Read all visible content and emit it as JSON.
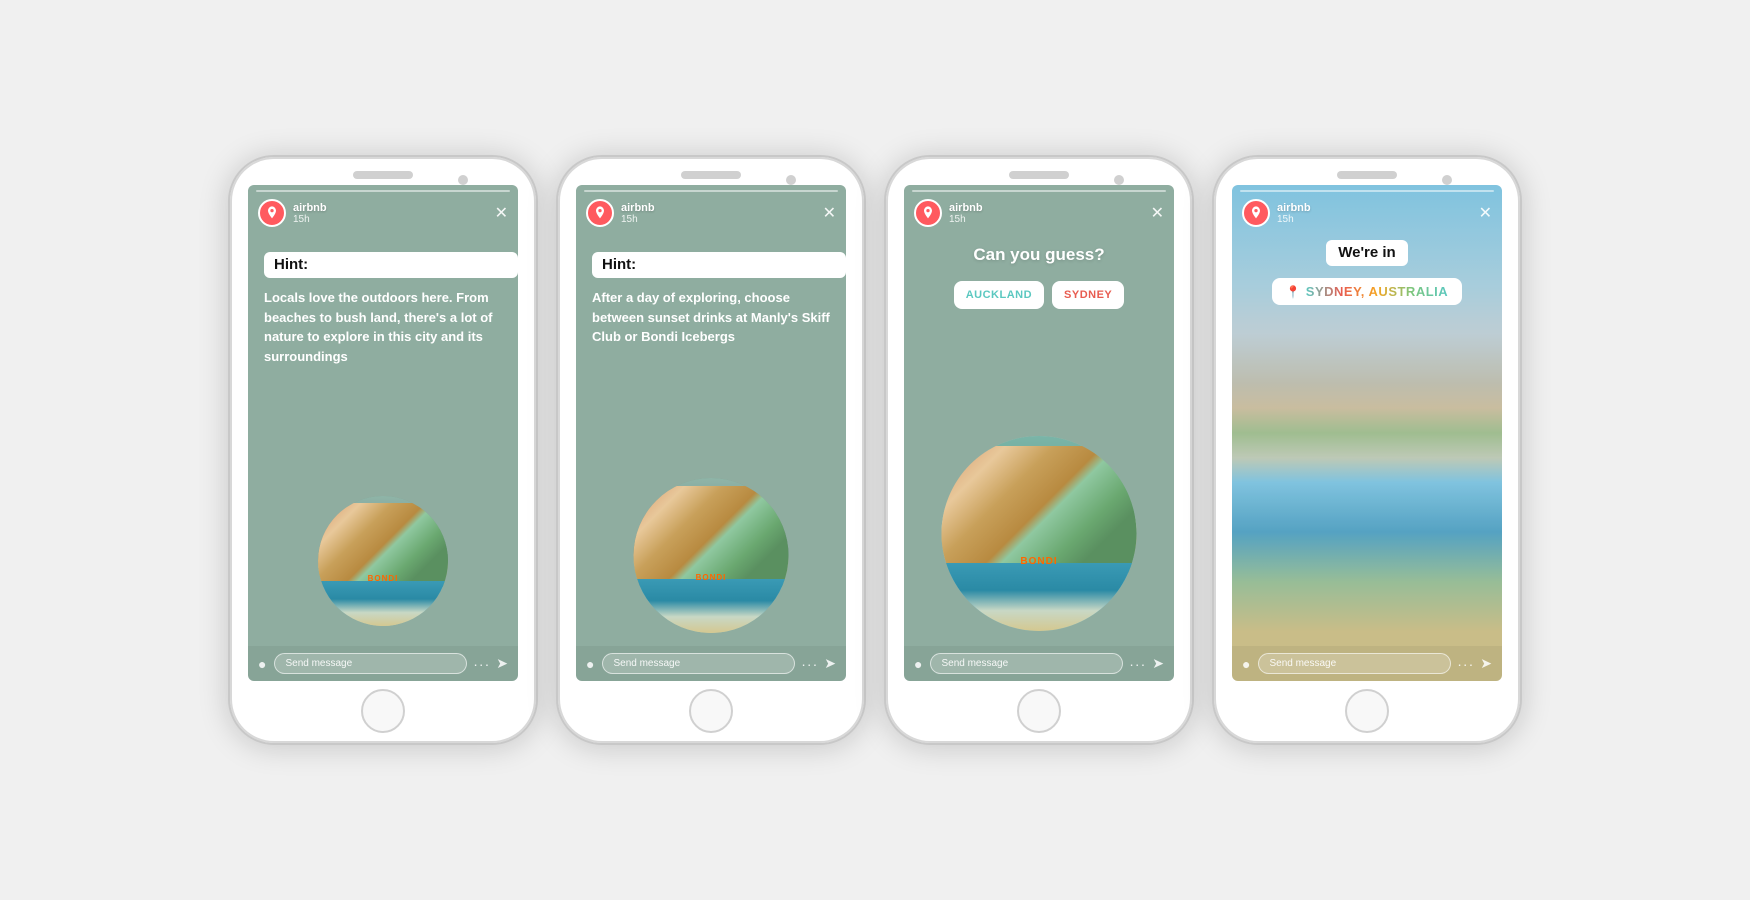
{
  "phones": [
    {
      "id": "phone1",
      "screen_type": "hint1",
      "header": {
        "username": "airbnb",
        "time": "15h"
      },
      "hint_label": "Hint:",
      "body_text": "Locals love the outdoors here. From beaches to bush land, there's a lot of nature to explore in this city and its surroundings",
      "footer": {
        "send_placeholder": "Send message"
      }
    },
    {
      "id": "phone2",
      "screen_type": "hint2",
      "header": {
        "username": "airbnb",
        "time": "15h"
      },
      "hint_label": "Hint:",
      "body_text": "After a day of exploring, choose between sunset drinks at Manly's Skiff Club or Bondi Icebergs",
      "footer": {
        "send_placeholder": "Send message"
      }
    },
    {
      "id": "phone3",
      "screen_type": "quiz",
      "header": {
        "username": "airbnb",
        "time": "15h"
      },
      "question": "Can you guess?",
      "options": [
        {
          "label": "AUCKLAND",
          "color": "auckland"
        },
        {
          "label": "SYDNEY",
          "color": "sydney"
        }
      ],
      "footer": {
        "send_placeholder": "Send message"
      }
    },
    {
      "id": "phone4",
      "screen_type": "reveal",
      "header": {
        "username": "airbnb",
        "time": "15h"
      },
      "were_in_label": "We're in",
      "location_text": "SYDNEY, AUSTRALIA",
      "footer": {
        "send_placeholder": "Send message"
      }
    }
  ]
}
